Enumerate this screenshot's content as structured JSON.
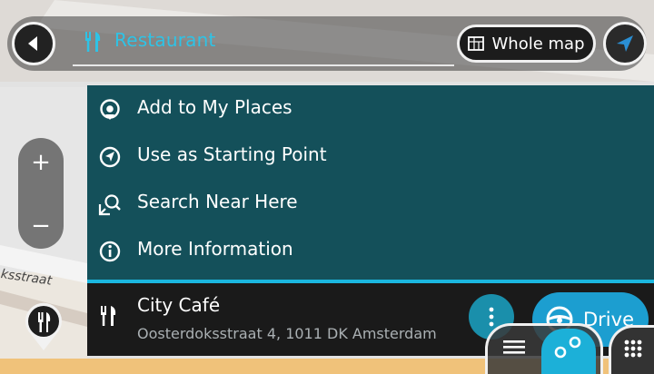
{
  "search": {
    "query": "Restaurant"
  },
  "header": {
    "whole_map_label": "Whole map"
  },
  "zoom": {
    "in_label": "+",
    "out_label": "−"
  },
  "popup_menu": {
    "items": [
      {
        "label": "Add to My Places",
        "icon": "place-pin-icon"
      },
      {
        "label": "Use as Starting Point",
        "icon": "starting-point-icon"
      },
      {
        "label": "Search Near Here",
        "icon": "search-near-icon"
      },
      {
        "label": "More Information",
        "icon": "info-icon"
      }
    ]
  },
  "location": {
    "name": "City Café",
    "address": "Oosterdoksstraat 4, 1011 DK Amsterdam",
    "icon": "restaurant-icon"
  },
  "actions": {
    "drive_label": "Drive"
  },
  "map": {
    "street_fragment": "ksstraat"
  },
  "colors": {
    "accent": "#1c9ed0",
    "menu_bg": "#14505a",
    "query_text": "#2ec3e6",
    "card_bg": "#1a1a1a"
  }
}
